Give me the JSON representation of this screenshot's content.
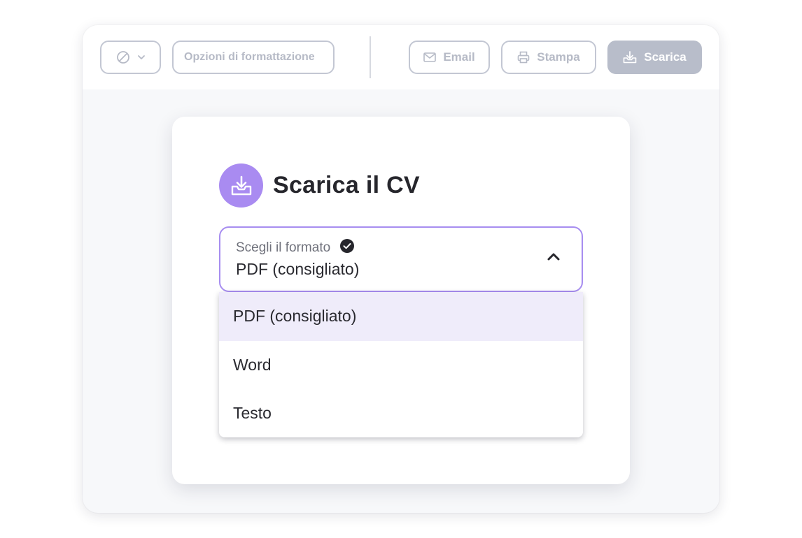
{
  "toolbar": {
    "style_icon": "no-style-icon",
    "formatting_label": "Opzioni di formattazione",
    "email_label": "Email",
    "print_label": "Stampa",
    "download_label": "Scarica"
  },
  "dialog": {
    "title": "Scarica il CV",
    "icon": "download-tray-icon",
    "select": {
      "label": "Scegli il formato",
      "value": "PDF (consigliato)",
      "expanded": true
    },
    "options": [
      "PDF (consigliato)",
      "Word",
      "Testo"
    ],
    "selected_index": 0
  },
  "colors": {
    "accent": "#a98bf1",
    "accent_border": "#a78df0",
    "selected_option_bg": "#efecfa",
    "disabled_button": "#b8bdca"
  }
}
